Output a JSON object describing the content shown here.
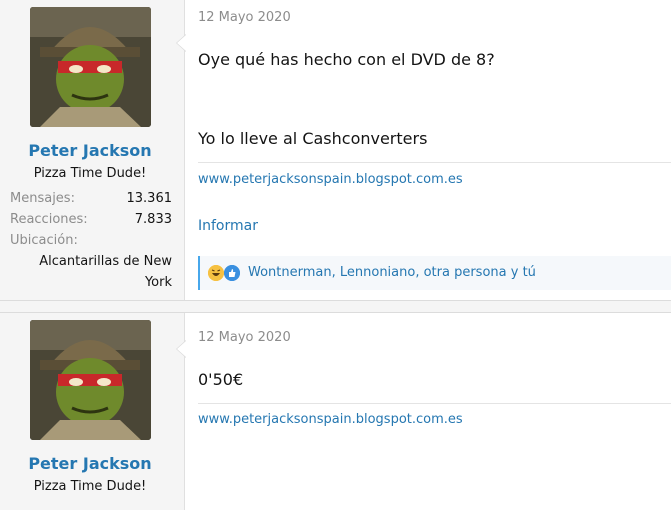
{
  "posts": [
    {
      "user": {
        "name": "Peter Jackson",
        "title": "Pizza Time Dude!",
        "stats": [
          {
            "label": "Mensajes:",
            "value": "13.361"
          },
          {
            "label": "Reacciones:",
            "value": "7.833"
          },
          {
            "label": "Ubicación:",
            "value": ""
          }
        ],
        "location": "Alcantarillas de New York"
      },
      "date": "12 Mayo 2020",
      "body": [
        "Oye qué has hecho con el DVD de 8?",
        "Yo lo lleve al Cashconverters"
      ],
      "signature": "www.peterjacksonspain.blogspot.com.es",
      "report_label": "Informar",
      "reactions": {
        "icons": [
          "laugh-emoji-icon",
          "like-emoji-icon"
        ],
        "text": "Wontnerman, Lennoniano, otra persona y tú"
      }
    },
    {
      "user": {
        "name": "Peter Jackson",
        "title": "Pizza Time Dude!"
      },
      "date": "12 Mayo 2020",
      "body": [
        "0'50€"
      ],
      "signature": "www.peterjacksonspain.blogspot.com.es"
    }
  ],
  "colors": {
    "link": "#2577b1",
    "muted": "#8c8c8c",
    "accent": "#47a7eb"
  }
}
